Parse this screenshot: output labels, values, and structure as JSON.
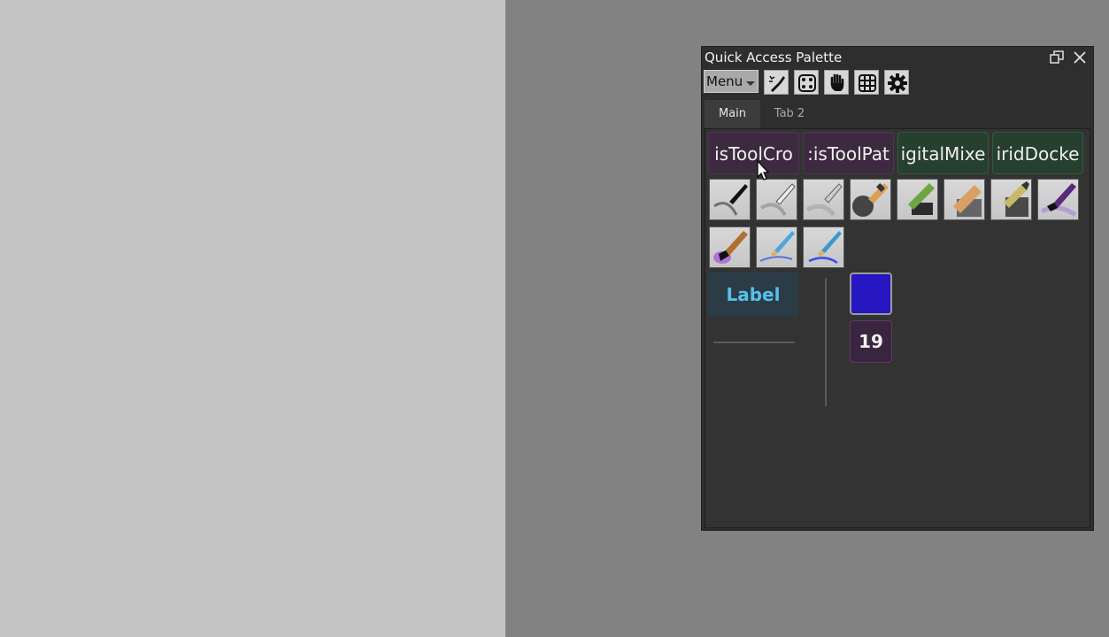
{
  "palette": {
    "title": "Quick Access Palette",
    "menu_label": "Menu",
    "toolbar_icons": [
      "brush-edit-icon",
      "dice-icon",
      "hand-icon",
      "grid-icon",
      "gear-icon"
    ],
    "tabs": [
      {
        "label": "Main",
        "active": true
      },
      {
        "label": "Tab 2",
        "active": false
      }
    ],
    "buttons": [
      {
        "label": "isToolCro",
        "color": "#3e2a40"
      },
      {
        "label": ":isToolPat",
        "color": "#3e2a40"
      },
      {
        "label": "igitalMixe",
        "color": "#273f2e"
      },
      {
        "label": "iridDocke",
        "color": "#273f2e"
      }
    ],
    "brushes": [
      "brush-preset-1",
      "brush-preset-2",
      "brush-preset-3",
      "brush-preset-4",
      "brush-preset-5",
      "brush-preset-6",
      "brush-preset-7",
      "brush-preset-8",
      "brush-preset-9",
      "brush-preset-10",
      "brush-preset-11"
    ],
    "label_widget": "Label",
    "color_swatch": "#2617c3",
    "number_value": "19"
  }
}
